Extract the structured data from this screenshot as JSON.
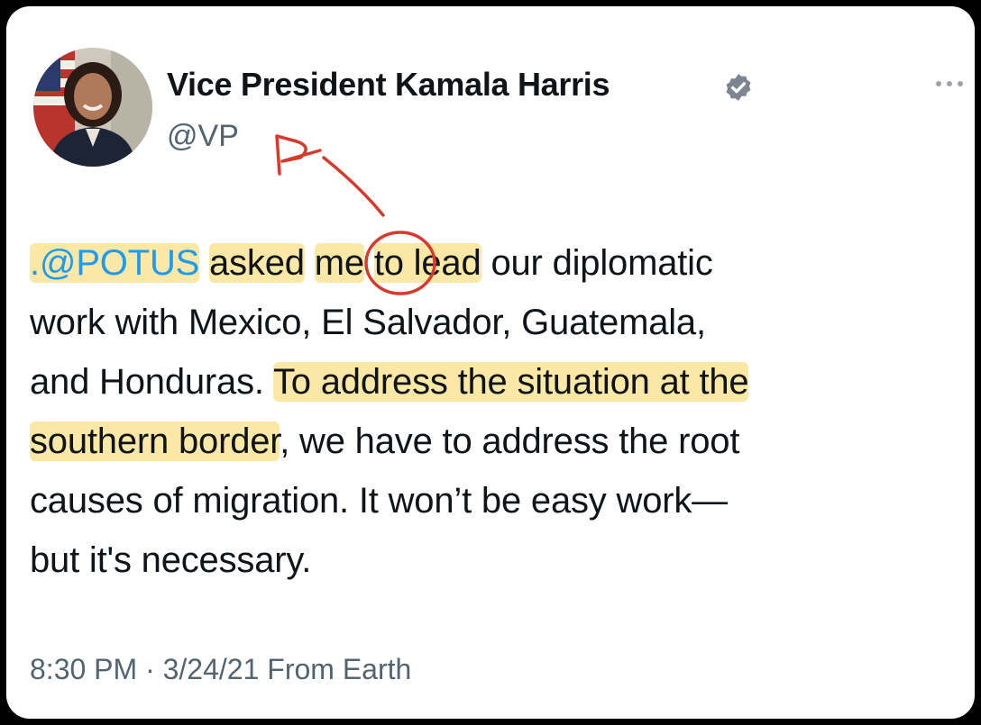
{
  "tweet": {
    "display_name": "Vice President Kamala Harris",
    "handle": "@VP",
    "verified_color": "#7d8590",
    "mention": ".@POTUS",
    "line1": {
      "asked": "asked",
      "me": "me",
      "to_lead": "to lead",
      "rest": "our diplomatic"
    },
    "line2": "work with Mexico, El Salvador, Guatemala,",
    "line3": {
      "plain": "and Honduras. ",
      "highlight": "To address the situation at the"
    },
    "line4": {
      "highlight": "southern border",
      "rest": ", we have to address the root"
    },
    "line5": "causes of migration. It won’t be easy work—",
    "line6": "but it's necessary.",
    "timestamp": "8:30 PM · 3/24/21 From Earth"
  },
  "colors": {
    "mention": "#1d9bf0",
    "highlight": "#f7d65c",
    "annotation": "#d63a2a",
    "secondary_text": "#536471"
  },
  "icons": {
    "verified": "verified-badge-icon",
    "more": "more-options-icon"
  }
}
